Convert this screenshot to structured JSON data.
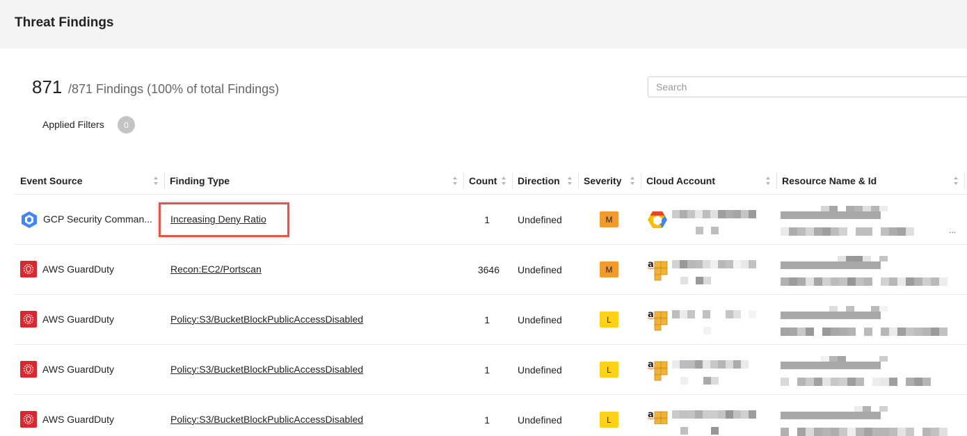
{
  "page": {
    "title": "Threat Findings"
  },
  "summary": {
    "count": "871",
    "total_text": "/871 Findings (100% of total Findings)"
  },
  "search": {
    "placeholder": "Search",
    "value": ""
  },
  "filters": {
    "label": "Applied Filters",
    "count": "0"
  },
  "table": {
    "columns": [
      "Event Source",
      "Finding Type",
      "Count",
      "Direction",
      "Severity",
      "Cloud Account",
      "Resource Name & Id"
    ],
    "rows": [
      {
        "source": "GCP Security Comman...",
        "source_icon": "gcp-security-icon",
        "finding": "Increasing Deny Ratio",
        "count": "1",
        "direction": "Undefined",
        "severity": "M",
        "account_icon": "gcp-logo-icon"
      },
      {
        "source": "AWS GuardDuty",
        "source_icon": "aws-guardduty-icon",
        "finding": "Recon:EC2/Portscan",
        "count": "3646",
        "direction": "Undefined",
        "severity": "M",
        "account_icon": "aws-logo-icon"
      },
      {
        "source": "AWS GuardDuty",
        "source_icon": "aws-guardduty-icon",
        "finding": "Policy:S3/BucketBlockPublicAccessDisabled",
        "count": "1",
        "direction": "Undefined",
        "severity": "L",
        "account_icon": "aws-logo-icon"
      },
      {
        "source": "AWS GuardDuty",
        "source_icon": "aws-guardduty-icon",
        "finding": "Policy:S3/BucketBlockPublicAccessDisabled",
        "count": "1",
        "direction": "Undefined",
        "severity": "L",
        "account_icon": "aws-logo-icon"
      },
      {
        "source": "AWS GuardDuty",
        "source_icon": "aws-guardduty-icon",
        "finding": "Policy:S3/BucketBlockPublicAccessDisabled",
        "count": "1",
        "direction": "Undefined",
        "severity": "L",
        "account_icon": "aws-logo-icon"
      }
    ],
    "ellipsis": "..."
  },
  "colors": {
    "highlight": "#e1564a",
    "severity_medium": "#f29a2e",
    "severity_low": "#fcd116",
    "guardduty": "#d9282f"
  }
}
